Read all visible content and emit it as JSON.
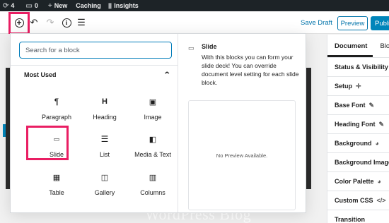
{
  "adminbar": {
    "comments_count": "4",
    "pending_count": "0",
    "new_label": "New",
    "caching_label": "Caching",
    "insights_label": "Insights"
  },
  "toolbar": {
    "save_draft": "Save Draft",
    "preview": "Preview",
    "publish": "Publi"
  },
  "inserter": {
    "search_placeholder": "Search for a block",
    "section_title": "Most Used",
    "blocks": [
      {
        "label": "Paragraph",
        "icon": "paragraph-icon"
      },
      {
        "label": "Heading",
        "icon": "heading-icon"
      },
      {
        "label": "Image",
        "icon": "image-icon"
      },
      {
        "label": "Slide",
        "icon": "slide-icon"
      },
      {
        "label": "List",
        "icon": "list-icon"
      },
      {
        "label": "Media & Text",
        "icon": "media-text-icon"
      },
      {
        "label": "Table",
        "icon": "table-icon"
      },
      {
        "label": "Gallery",
        "icon": "gallery-icon"
      },
      {
        "label": "Columns",
        "icon": "columns-icon"
      }
    ],
    "preview": {
      "title": "Slide",
      "description": "With this blocks you can form your slide deck! You can override document level setting for each slide block.",
      "empty_text": "No Preview Available."
    }
  },
  "canvas": {
    "slide_text": "WordPress Blog"
  },
  "sidebar": {
    "tabs": [
      "Document",
      "Block"
    ],
    "items": [
      {
        "label": "Status & Visibility",
        "icon": ""
      },
      {
        "label": "Setup",
        "icon": "crosshair-icon"
      },
      {
        "label": "Base Font",
        "icon": "edit-icon"
      },
      {
        "label": "Heading Font",
        "icon": "edit-icon"
      },
      {
        "label": "Background",
        "icon": "palette-icon"
      },
      {
        "label": "Background Image",
        "icon": "image-icon"
      },
      {
        "label": "Color Palette",
        "icon": "palette-icon"
      },
      {
        "label": "Custom CSS",
        "icon": "code-icon"
      },
      {
        "label": "Transition",
        "icon": ""
      }
    ]
  },
  "colors": {
    "accent": "#0085ba",
    "highlight": "#e91e63"
  }
}
